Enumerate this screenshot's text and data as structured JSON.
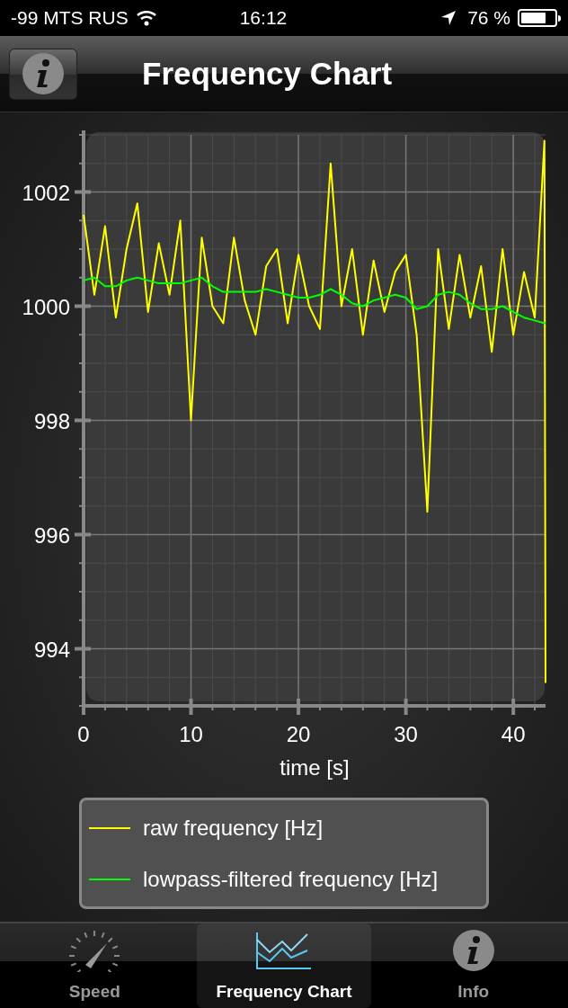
{
  "status_bar": {
    "carrier": "-99 MTS RUS",
    "time": "16:12",
    "battery": "76 %"
  },
  "nav_bar": {
    "title": "Frequency Chart"
  },
  "chart": {
    "chart_data": {
      "type": "line",
      "grid": true,
      "xlabel": "time [s]",
      "xlim": [
        0,
        43
      ],
      "ylim": [
        993,
        1003
      ],
      "xticks": [
        0,
        10,
        20,
        30,
        40
      ],
      "yticks": [
        994,
        996,
        998,
        1000,
        1002
      ],
      "x": [
        0,
        1,
        2,
        3,
        4,
        5,
        6,
        7,
        8,
        9,
        10,
        11,
        12,
        13,
        14,
        15,
        16,
        17,
        18,
        19,
        20,
        21,
        22,
        23,
        24,
        25,
        26,
        27,
        28,
        29,
        30,
        31,
        32,
        33,
        34,
        35,
        36,
        37,
        38,
        39,
        40,
        41,
        42,
        42.9,
        43
      ],
      "series": [
        {
          "name": "raw frequency [Hz]",
          "color": "#ffff00",
          "values": [
            1001.6,
            1000.2,
            1001.4,
            999.8,
            1001.0,
            1001.8,
            999.9,
            1001.1,
            1000.2,
            1001.5,
            998.0,
            1001.2,
            1000.0,
            999.7,
            1001.2,
            1000.1,
            999.5,
            1000.7,
            1001.0,
            999.7,
            1000.9,
            1000.0,
            999.6,
            1002.5,
            1000.0,
            1001.0,
            999.5,
            1000.8,
            999.9,
            1000.6,
            1000.9,
            999.5,
            996.4,
            1001.0,
            999.6,
            1000.9,
            999.8,
            1000.7,
            999.2,
            1001.0,
            999.5,
            1000.6,
            999.8,
            1002.9,
            993.4
          ]
        },
        {
          "name": "lowpass-filtered frequency [Hz]",
          "color": "#00ff00",
          "values": [
            1000.45,
            1000.5,
            1000.35,
            1000.35,
            1000.45,
            1000.5,
            1000.45,
            1000.4,
            1000.4,
            1000.4,
            1000.45,
            1000.5,
            1000.35,
            1000.25,
            1000.25,
            1000.25,
            1000.25,
            1000.3,
            1000.25,
            1000.2,
            1000.15,
            1000.15,
            1000.2,
            1000.3,
            1000.2,
            1000.05,
            1000.0,
            1000.1,
            1000.15,
            1000.2,
            1000.15,
            999.95,
            1000.0,
            1000.2,
            1000.25,
            1000.2,
            1000.05,
            999.95,
            999.95,
            1000.0,
            999.9,
            999.8,
            999.75,
            999.7,
            999.7
          ]
        }
      ]
    }
  },
  "tab_bar": [
    {
      "kind": "speed",
      "label": "Speed",
      "selected": false
    },
    {
      "kind": "chart",
      "label": "Frequency Chart",
      "selected": true
    },
    {
      "kind": "info",
      "label": "Info",
      "selected": false
    }
  ]
}
